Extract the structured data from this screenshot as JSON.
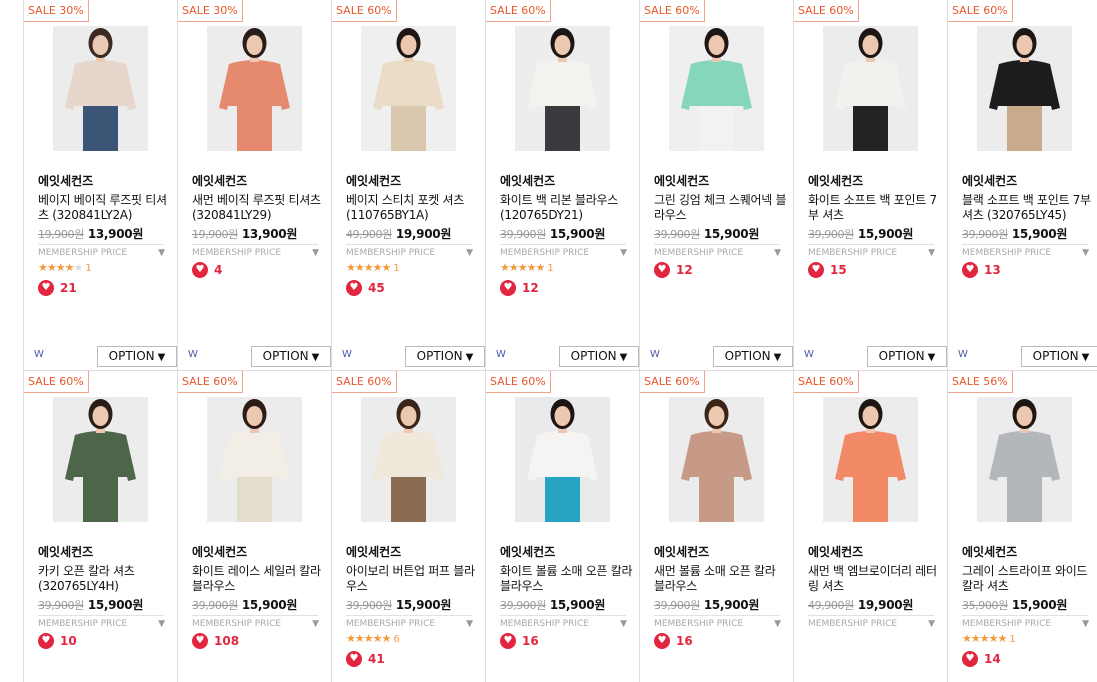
{
  "labels": {
    "membership_price": "MEMBERSHIP PRICE",
    "option": "OPTION",
    "w_mark": "W"
  },
  "colors": {
    "sale": "#e8572b",
    "heart": "#e3263f",
    "star": "#f29a3b"
  },
  "products": [
    {
      "sale": "SALE 30%",
      "brand": "에잇세컨즈",
      "name": "베이지 베이직 루즈핏 티셔츠 (320841LY2A)",
      "orig_price": "19,900원",
      "price": "13,900원",
      "rating_stars": 4,
      "review_count": "1",
      "likes": "21",
      "img": {
        "bg": "#ececec",
        "top": "#e6d6cc",
        "bottom": "#3b5576",
        "skin": "#e8c9b3",
        "hair": "#3a2a22"
      }
    },
    {
      "sale": "SALE 30%",
      "brand": "에잇세컨즈",
      "name": "새먼 베이직 루즈핏 티셔츠 (320841LY29)",
      "orig_price": "19,900원",
      "price": "13,900원",
      "rating_stars": null,
      "review_count": null,
      "likes": "4",
      "img": {
        "bg": "#ececec",
        "top": "#e58a6e",
        "bottom": "#e58a6e",
        "skin": "#ecc8b0",
        "hair": "#2a1d18"
      }
    },
    {
      "sale": "SALE 60%",
      "brand": "에잇세컨즈",
      "name": "베이지 스티치 포켓 셔츠 (110765BY1A)",
      "orig_price": "49,900원",
      "price": "19,900원",
      "rating_stars": 5,
      "review_count": "1",
      "likes": "45",
      "img": {
        "bg": "#efefef",
        "top": "#eadcc6",
        "bottom": "#d9c8ae",
        "skin": "#ecc8b0",
        "hair": "#1f1714"
      }
    },
    {
      "sale": "SALE 60%",
      "brand": "에잇세컨즈",
      "name": "화이트 백 리본 블라우스 (120765DY21)",
      "orig_price": "39,900원",
      "price": "15,900원",
      "rating_stars": 5,
      "review_count": "1",
      "likes": "12",
      "img": {
        "bg": "#ededed",
        "top": "#f4f2ef",
        "bottom": "#3a3a3e",
        "skin": "#ecc8b0",
        "hair": "#1c1514"
      }
    },
    {
      "sale": "SALE 60%",
      "brand": "에잇세컨즈",
      "name": "그린 깅엄 체크 스퀘어넥 블라우스",
      "orig_price": "39,900원",
      "price": "15,900원",
      "rating_stars": null,
      "review_count": null,
      "likes": "12",
      "img": {
        "bg": "#efefef",
        "top": "#86d6bd",
        "bottom": "#f2f2f2",
        "skin": "#ecc8b0",
        "hair": "#1e1614"
      }
    },
    {
      "sale": "SALE 60%",
      "brand": "에잇세컨즈",
      "name": "화이트 소프트 백 포인트 7부 셔츠",
      "orig_price": "39,900원",
      "price": "15,900원",
      "rating_stars": null,
      "review_count": null,
      "likes": "15",
      "img": {
        "bg": "#ececec",
        "top": "#f2f1ee",
        "bottom": "#222224",
        "skin": "#ecc8b0",
        "hair": "#1e1614"
      }
    },
    {
      "sale": "SALE 60%",
      "brand": "에잇세컨즈",
      "name": "블랙 소프트 백 포인트 7부 셔츠 (320765LY45)",
      "orig_price": "39,900원",
      "price": "15,900원",
      "rating_stars": null,
      "review_count": null,
      "likes": "13",
      "img": {
        "bg": "#ececec",
        "top": "#1d1d1f",
        "bottom": "#c8ab8c",
        "skin": "#ecc8b0",
        "hair": "#1e1614"
      }
    },
    {
      "sale": "SALE 60%",
      "brand": "에잇세컨즈",
      "name": "카키 오픈 칼라 셔츠 (320765LY4H)",
      "orig_price": "39,900원",
      "price": "15,900원",
      "rating_stars": null,
      "review_count": null,
      "likes": "10",
      "img": {
        "bg": "#ececec",
        "top": "#4d6548",
        "bottom": "#4d6548",
        "skin": "#ecc8b0",
        "hair": "#2a1d18"
      }
    },
    {
      "sale": "SALE 60%",
      "brand": "에잇세컨즈",
      "name": "화이트 레이스 세일러 칼라 블라우스",
      "orig_price": "39,900원",
      "price": "15,900원",
      "rating_stars": null,
      "review_count": null,
      "likes": "108",
      "img": {
        "bg": "#ececec",
        "top": "#f2eee6",
        "bottom": "#e3dccf",
        "skin": "#ecc8b0",
        "hair": "#2a1d18"
      }
    },
    {
      "sale": "SALE 60%",
      "brand": "에잇세컨즈",
      "name": "아이보리 버튼업 퍼프 블라우스",
      "orig_price": "39,900원",
      "price": "15,900원",
      "rating_stars": 5,
      "review_count": "6",
      "likes": "41",
      "img": {
        "bg": "#ececec",
        "top": "#f0e8da",
        "bottom": "#8b6c52",
        "skin": "#ecc8b0",
        "hair": "#3a2418"
      }
    },
    {
      "sale": "SALE 60%",
      "brand": "에잇세컨즈",
      "name": "화이트 볼륨 소매 오픈 칼라 블라우스",
      "orig_price": "39,900원",
      "price": "15,900원",
      "rating_stars": null,
      "review_count": null,
      "likes": "16",
      "img": {
        "bg": "#e8eaec",
        "top": "#f5f4f2",
        "bottom": "#27a4c4",
        "skin": "#ecc8b0",
        "hair": "#1c1514"
      }
    },
    {
      "sale": "SALE 60%",
      "brand": "에잇세컨즈",
      "name": "새먼 볼륨 소매 오픈 칼라 블라우스",
      "orig_price": "39,900원",
      "price": "15,900원",
      "rating_stars": null,
      "review_count": null,
      "likes": "16",
      "img": {
        "bg": "#ececec",
        "top": "#c79a88",
        "bottom": "#c79a88",
        "skin": "#ecc8b0",
        "hair": "#3a2418"
      }
    },
    {
      "sale": "SALE 60%",
      "brand": "에잇세컨즈",
      "name": "새먼 백 엠브로이더리 레터링 셔츠",
      "orig_price": "49,900원",
      "price": "19,900원",
      "rating_stars": null,
      "review_count": null,
      "likes": null,
      "img": {
        "bg": "#ececec",
        "top": "#f28a68",
        "bottom": "#f28a68",
        "skin": "#ecc8b0",
        "hair": "#1e1614"
      }
    },
    {
      "sale": "SALE 56%",
      "brand": "에잇세컨즈",
      "name": "그레이 스트라이프 와이드 칼라 셔츠",
      "orig_price": "35,900원",
      "price": "15,900원",
      "rating_stars": 5,
      "review_count": "1",
      "likes": "14",
      "img": {
        "bg": "#ececec",
        "top": "#b3b6bb",
        "bottom": "#b3b6bb",
        "skin": "#ecc8b0",
        "hair": "#1e1614"
      }
    }
  ]
}
